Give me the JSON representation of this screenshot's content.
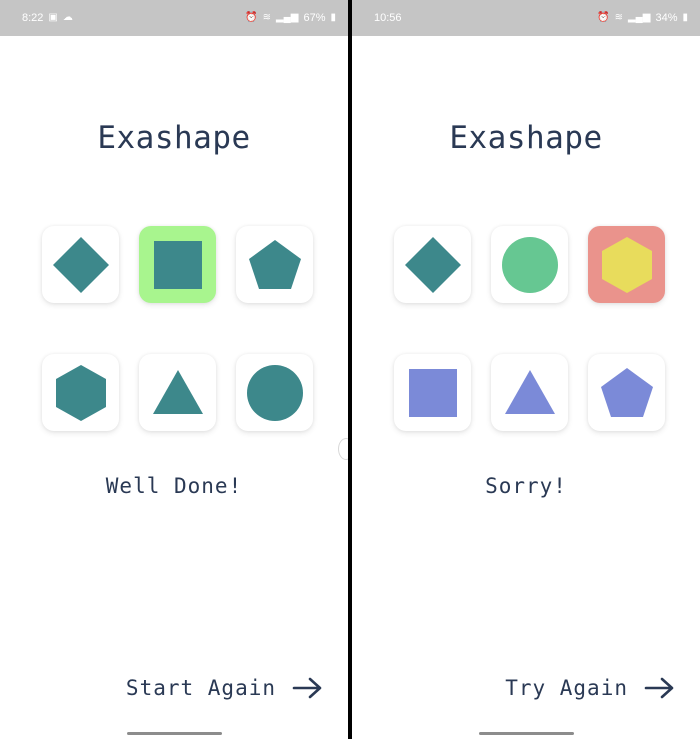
{
  "colors": {
    "teal": "#3d888b",
    "highlight_green": "#a8f58e",
    "circle_green": "#66c792",
    "wrong_red": "#ea938c",
    "hexagon_yellow": "#e8dc5c",
    "periwinkle": "#7b8ad8",
    "text": "#2a3954"
  },
  "left_screen": {
    "status": {
      "time": "8:22",
      "battery": "67%"
    },
    "title": "Exashape",
    "tiles": [
      {
        "shape": "diamond",
        "color": "teal",
        "highlight": null
      },
      {
        "shape": "square",
        "color": "teal",
        "highlight": "highlight_green"
      },
      {
        "shape": "pentagon",
        "color": "teal",
        "highlight": null
      },
      {
        "shape": "hexagon",
        "color": "teal",
        "highlight": null
      },
      {
        "shape": "triangle",
        "color": "teal",
        "highlight": null
      },
      {
        "shape": "circle",
        "color": "teal",
        "highlight": null
      }
    ],
    "message": "Well Done!",
    "action_label": "Start Again"
  },
  "right_screen": {
    "status": {
      "time": "10:56",
      "battery": "34%"
    },
    "title": "Exashape",
    "tiles": [
      {
        "shape": "diamond",
        "color": "teal",
        "highlight": null
      },
      {
        "shape": "circle",
        "color": "circle_green",
        "highlight": null
      },
      {
        "shape": "hexagon",
        "color": "hexagon_yellow",
        "highlight": "wrong_red"
      },
      {
        "shape": "square",
        "color": "periwinkle",
        "highlight": null
      },
      {
        "shape": "triangle",
        "color": "periwinkle",
        "highlight": null
      },
      {
        "shape": "pentagon",
        "color": "periwinkle",
        "highlight": null
      }
    ],
    "message": "Sorry!",
    "action_label": "Try Again"
  }
}
